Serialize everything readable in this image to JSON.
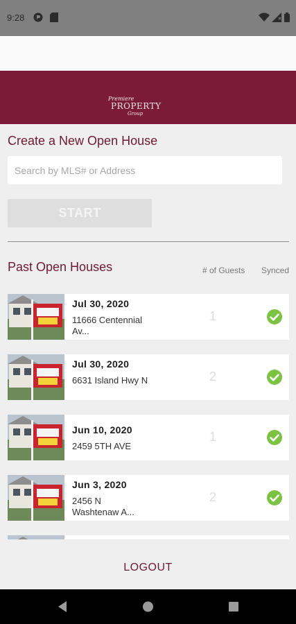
{
  "status_bar": {
    "time": "9:28"
  },
  "header": {
    "logo": "Premiere Property Group, LLC"
  },
  "create": {
    "title": "Create a New Open House",
    "search_placeholder": "Search by MLS# or Address",
    "start_label": "START"
  },
  "past": {
    "title": "Past Open Houses",
    "col_guests": "# of Guests",
    "col_synced": "Synced",
    "items": [
      {
        "date": "Jul 30, 2020",
        "address": "11666 Centennial Av...",
        "guests": "1",
        "synced": true
      },
      {
        "date": "Jul 30, 2020",
        "address": "6631 Island Hwy N",
        "guests": "2",
        "synced": true
      },
      {
        "date": "Jun 10, 2020",
        "address": "2459 5TH AVE",
        "guests": "1",
        "synced": true
      },
      {
        "date": "Jun 3, 2020",
        "address": "2456 N Washtenaw A...",
        "guests": "2",
        "synced": true
      }
    ]
  },
  "footer": {
    "logout_label": "LOGOUT"
  },
  "colors": {
    "brand": "#7a1b3a",
    "synced_check": "#7cc243"
  },
  "icons": {
    "status": [
      "app-icon",
      "sd-card-icon",
      "wifi-icon",
      "signal-icon",
      "battery-icon"
    ],
    "nav": [
      "back-icon",
      "home-icon",
      "recents-icon"
    ]
  }
}
